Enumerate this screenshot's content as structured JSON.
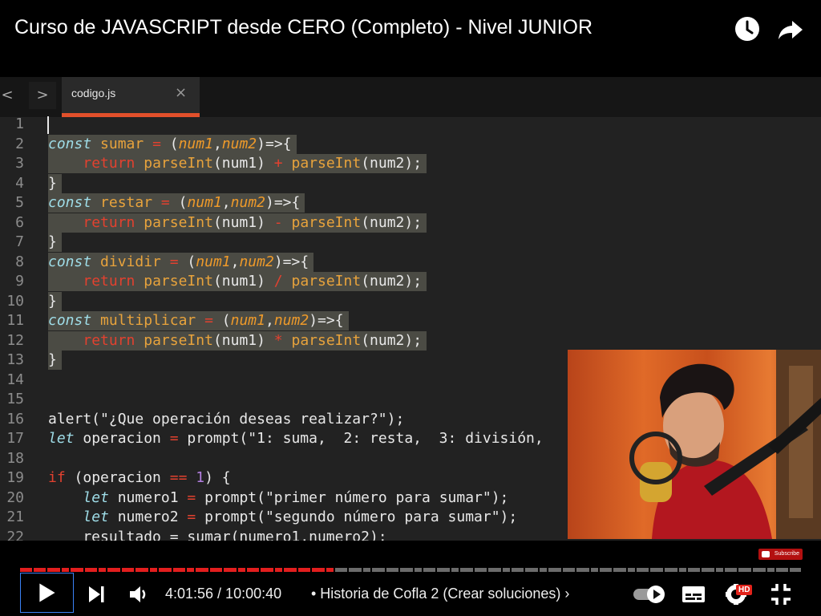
{
  "video": {
    "title": "Curso de JAVASCRIPT desde CERO (Completo) - Nivel JUNIOR"
  },
  "editor": {
    "tab_name": "codigo.js",
    "tab_close": "×",
    "nav_back": "<",
    "nav_forward": ">",
    "line_numbers": [
      "1",
      "2",
      "3",
      "4",
      "5",
      "6",
      "7",
      "8",
      "9",
      "10",
      "11",
      "12",
      "13",
      "14",
      "15",
      "16",
      "17",
      "18",
      "19",
      "20",
      "21",
      "22"
    ],
    "selected_lines": [
      1,
      2,
      3,
      4,
      5,
      6,
      7,
      8,
      9,
      10,
      11,
      12,
      13
    ],
    "lines": [
      [],
      [
        [
          "const",
          "kw"
        ],
        [
          " "
        ],
        [
          "sumar",
          "fn"
        ],
        [
          " "
        ],
        [
          "=",
          "op"
        ],
        [
          " ("
        ],
        [
          "num1",
          "ar"
        ],
        [
          ","
        ],
        [
          "num2",
          "ar"
        ],
        [
          ")=>{"
        ]
      ],
      [
        [
          "    "
        ],
        [
          "return",
          "op"
        ],
        [
          " "
        ],
        [
          "parseInt",
          "fn"
        ],
        [
          "(num1) "
        ],
        [
          "+",
          "op"
        ],
        [
          " "
        ],
        [
          "parseInt",
          "fn"
        ],
        [
          "(num2);"
        ]
      ],
      [
        [
          "}"
        ]
      ],
      [
        [
          "const",
          "kw"
        ],
        [
          " "
        ],
        [
          "restar",
          "fn"
        ],
        [
          " "
        ],
        [
          "=",
          "op"
        ],
        [
          " ("
        ],
        [
          "num1",
          "ar"
        ],
        [
          ","
        ],
        [
          "num2",
          "ar"
        ],
        [
          ")=>{"
        ]
      ],
      [
        [
          "    "
        ],
        [
          "return",
          "op"
        ],
        [
          " "
        ],
        [
          "parseInt",
          "fn"
        ],
        [
          "(num1) "
        ],
        [
          "-",
          "op"
        ],
        [
          " "
        ],
        [
          "parseInt",
          "fn"
        ],
        [
          "(num2);"
        ]
      ],
      [
        [
          "}"
        ]
      ],
      [
        [
          "const",
          "kw"
        ],
        [
          " "
        ],
        [
          "dividir",
          "fn"
        ],
        [
          " "
        ],
        [
          "=",
          "op"
        ],
        [
          " ("
        ],
        [
          "num1",
          "ar"
        ],
        [
          ","
        ],
        [
          "num2",
          "ar"
        ],
        [
          ")=>{"
        ]
      ],
      [
        [
          "    "
        ],
        [
          "return",
          "op"
        ],
        [
          " "
        ],
        [
          "parseInt",
          "fn"
        ],
        [
          "(num1) "
        ],
        [
          "/",
          "op"
        ],
        [
          " "
        ],
        [
          "parseInt",
          "fn"
        ],
        [
          "(num2);"
        ]
      ],
      [
        [
          "}"
        ]
      ],
      [
        [
          "const",
          "kw"
        ],
        [
          " "
        ],
        [
          "multiplicar",
          "fn"
        ],
        [
          " "
        ],
        [
          "=",
          "op"
        ],
        [
          " ("
        ],
        [
          "num1",
          "ar"
        ],
        [
          ","
        ],
        [
          "num2",
          "ar"
        ],
        [
          ")=>{"
        ]
      ],
      [
        [
          "    "
        ],
        [
          "return",
          "op"
        ],
        [
          " "
        ],
        [
          "parseInt",
          "fn"
        ],
        [
          "(num1) "
        ],
        [
          "*",
          "op"
        ],
        [
          " "
        ],
        [
          "parseInt",
          "fn"
        ],
        [
          "(num2);"
        ]
      ],
      [
        [
          "}"
        ]
      ],
      [],
      [],
      [
        [
          "alert(\"¿Que operación deseas realizar?\");"
        ]
      ],
      [
        [
          "let",
          "kw"
        ],
        [
          " operacion "
        ],
        [
          "=",
          "op"
        ],
        [
          " prompt(\"1: suma,  2: resta,  3: división,"
        ]
      ],
      [],
      [
        [
          "if",
          "op"
        ],
        [
          " (operacion "
        ],
        [
          "==",
          "op"
        ],
        [
          " "
        ],
        [
          "1",
          "num"
        ],
        [
          ") {"
        ]
      ],
      [
        [
          "    "
        ],
        [
          "let",
          "kw"
        ],
        [
          " numero1 "
        ],
        [
          "=",
          "op"
        ],
        [
          " prompt(\"primer número para sumar\");"
        ]
      ],
      [
        [
          "    "
        ],
        [
          "let",
          "kw"
        ],
        [
          " numero2 "
        ],
        [
          "=",
          "op"
        ],
        [
          " prompt(\"segundo número para sumar\");"
        ]
      ],
      [
        [
          "    resultado = sumar(numero1,numero2);"
        ]
      ]
    ]
  },
  "watermark": {
    "subscribe_label": "Subscribe"
  },
  "player": {
    "current_time": "4:01:56",
    "duration": "10:00:40",
    "time_display": "4:01:56 / 10:00:40",
    "chapter_title": "• Historia de Cofla 2 (Crear soluciones) ›",
    "progress_fraction": 0.4029,
    "hd_badge": "HD",
    "colors": {
      "progress_played": "#e31e1e",
      "tab_accent": "#e2502b"
    }
  },
  "icons": {
    "watch_later": "clock-icon",
    "share": "share-arrow-icon",
    "play": "play-icon",
    "next": "next-icon",
    "volume": "volume-icon",
    "autoplay": "autoplay-toggle-icon",
    "captions": "captions-icon",
    "settings": "gear-icon",
    "fullscreen_exit": "exit-fullscreen-icon"
  }
}
